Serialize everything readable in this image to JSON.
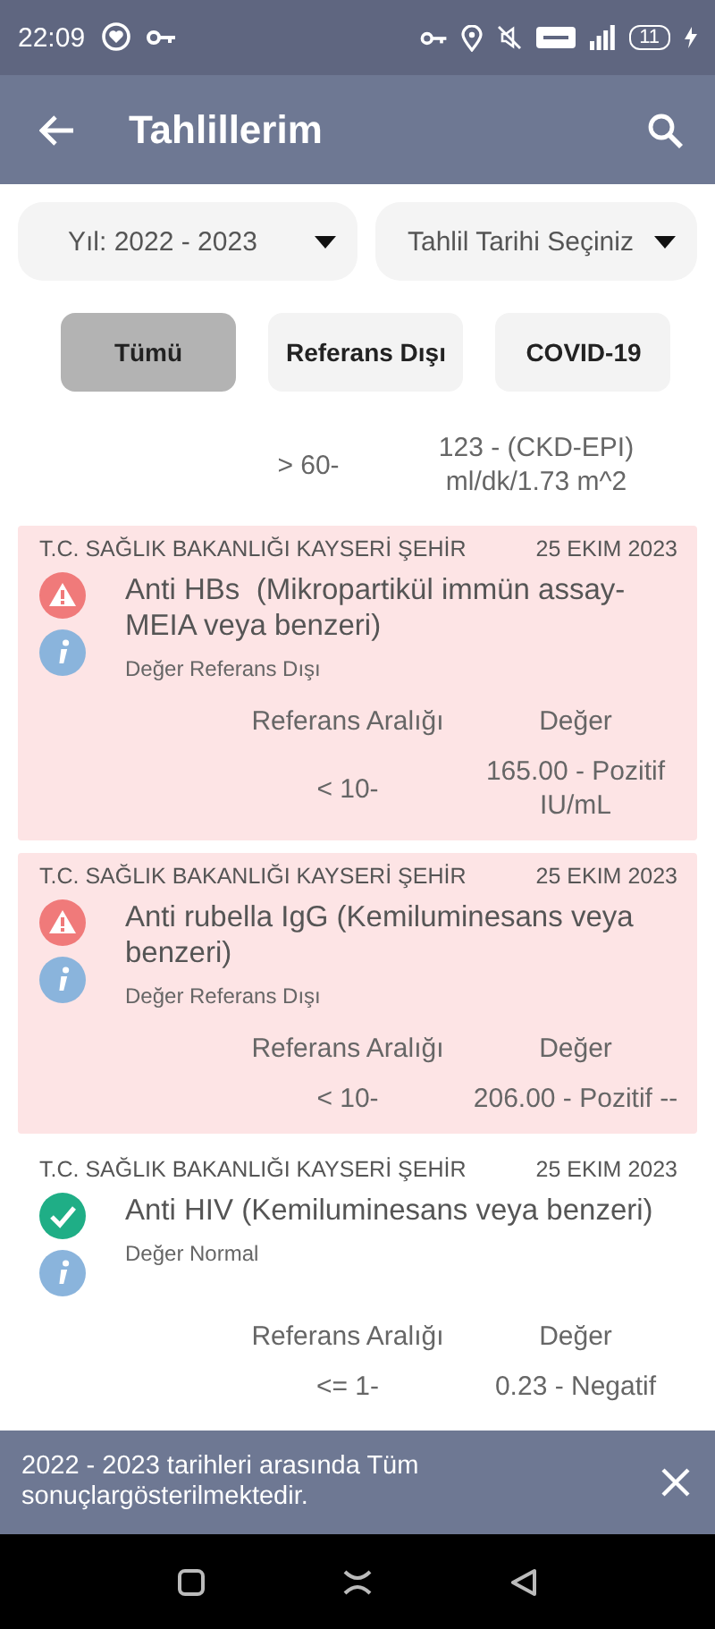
{
  "status_bar": {
    "time": "22:09",
    "battery": "11"
  },
  "app_bar": {
    "title": "Tahlillerim"
  },
  "dropdowns": [
    {
      "label": "Yıl: 2022 - 2023"
    },
    {
      "label": "Tahlil Tarihi Seçiniz"
    }
  ],
  "filters": [
    {
      "label": "Tümü",
      "selected": true
    },
    {
      "label": "Referans Dışı",
      "selected": false
    },
    {
      "label": "COVID-19",
      "selected": false
    }
  ],
  "partial_result": {
    "reference": "> 60-",
    "value": "123 - (CKD-EPI) ml/dk/1.73 m^2"
  },
  "results": [
    {
      "kind": "out_of_range",
      "institution": "T.C. SAĞLIK BAKANLIĞI KAYSERİ ŞEHİR",
      "date": "25 EKIM 2023",
      "test": "Anti HBs  (Mikropartikül immün assay-MEIA veya benzeri)",
      "status": "Değer Referans Dışı",
      "reference_header": "Referans Aralığı",
      "value_header": "Değer",
      "reference": "< 10-",
      "value": "165.00 - Pozitif IU/mL"
    },
    {
      "kind": "out_of_range",
      "institution": "T.C. SAĞLIK BAKANLIĞI KAYSERİ ŞEHİR",
      "date": "25 EKIM 2023",
      "test": "Anti rubella IgG (Kemiluminesans veya benzeri)",
      "status": "Değer Referans Dışı",
      "reference_header": "Referans Aralığı",
      "value_header": "Değer",
      "reference": "< 10-",
      "value": "206.00 - Pozitif --"
    },
    {
      "kind": "normal",
      "institution": "T.C. SAĞLIK BAKANLIĞI KAYSERİ ŞEHİR",
      "date": "25 EKIM 2023",
      "test": "Anti HIV (Kemiluminesans veya benzeri)",
      "status": "Değer Normal",
      "reference_header": "Referans Aralığı",
      "value_header": "Değer",
      "reference": "<= 1-",
      "value": "0.23 - Negatif"
    }
  ],
  "snackbar": {
    "message": "2022 - 2023 tarihleri arasında Tüm sonuçlargösterilmektedir."
  }
}
